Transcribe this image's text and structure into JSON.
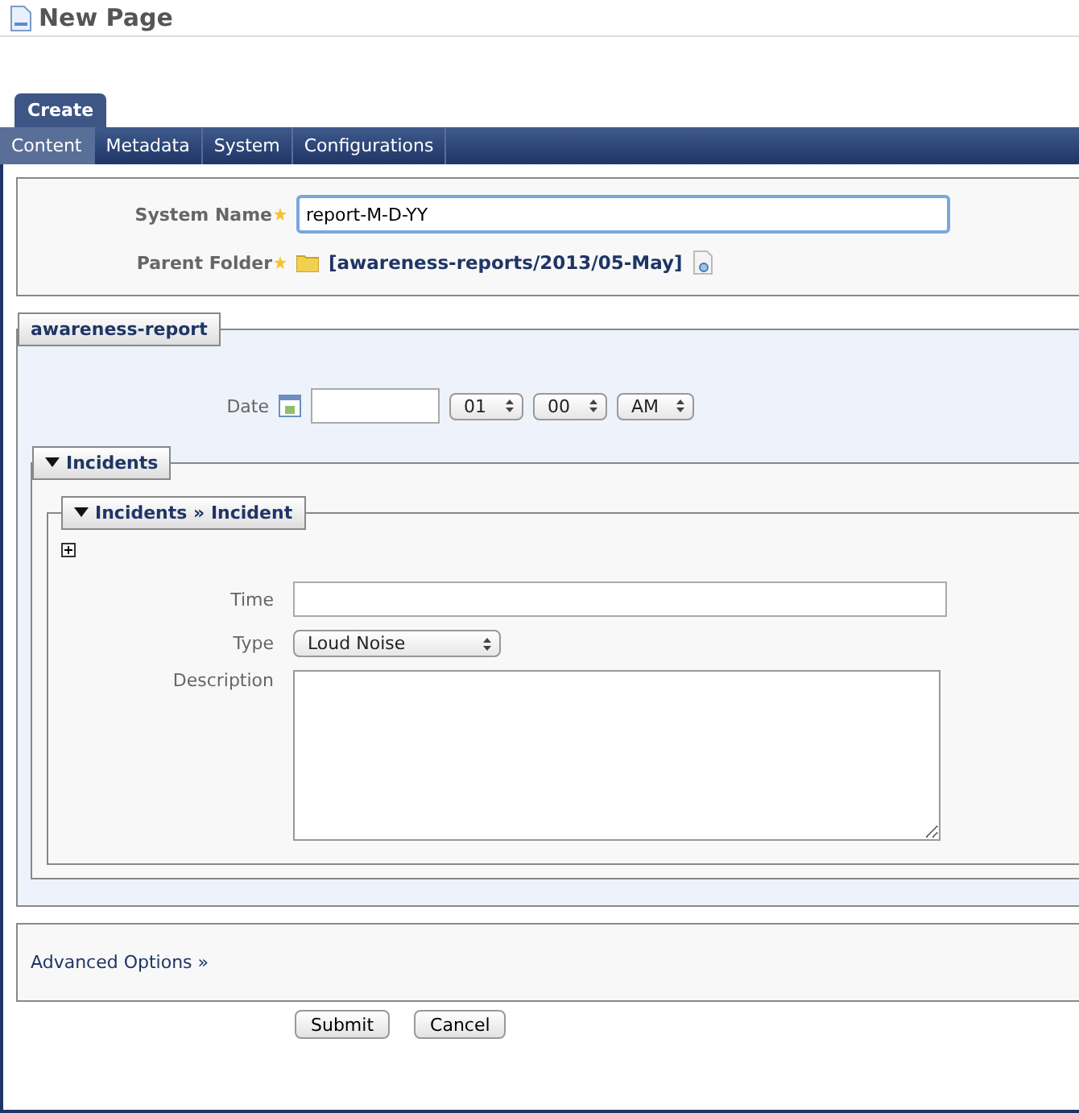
{
  "page_title": "New Page",
  "top_tabs": [
    {
      "label": "Create",
      "selected": true
    }
  ],
  "nav_tabs": [
    {
      "label": "Content",
      "selected": true
    },
    {
      "label": "Metadata",
      "selected": false
    },
    {
      "label": "System",
      "selected": false
    },
    {
      "label": "Configurations",
      "selected": false
    }
  ],
  "general": {
    "system_name": {
      "label": "System Name",
      "required": true,
      "value": "report-M-D-YY"
    },
    "parent_folder": {
      "label": "Parent Folder",
      "required": true,
      "path": "[awareness-reports/2013/05-May]"
    }
  },
  "awareness_report": {
    "legend": "awareness-report",
    "date": {
      "label": "Date",
      "hour": "01",
      "minute": "00",
      "ampm": "AM"
    },
    "incidents": {
      "legend": "Incidents",
      "expanded": true,
      "incident": {
        "legend": "Incidents » Incident",
        "expanded": true,
        "time": {
          "label": "Time"
        },
        "type": {
          "label": "Type",
          "value": "Loud Noise"
        },
        "description": {
          "label": "Description"
        }
      }
    }
  },
  "advanced_options": "Advanced Options »",
  "buttons": [
    "Submit",
    "Cancel"
  ]
}
